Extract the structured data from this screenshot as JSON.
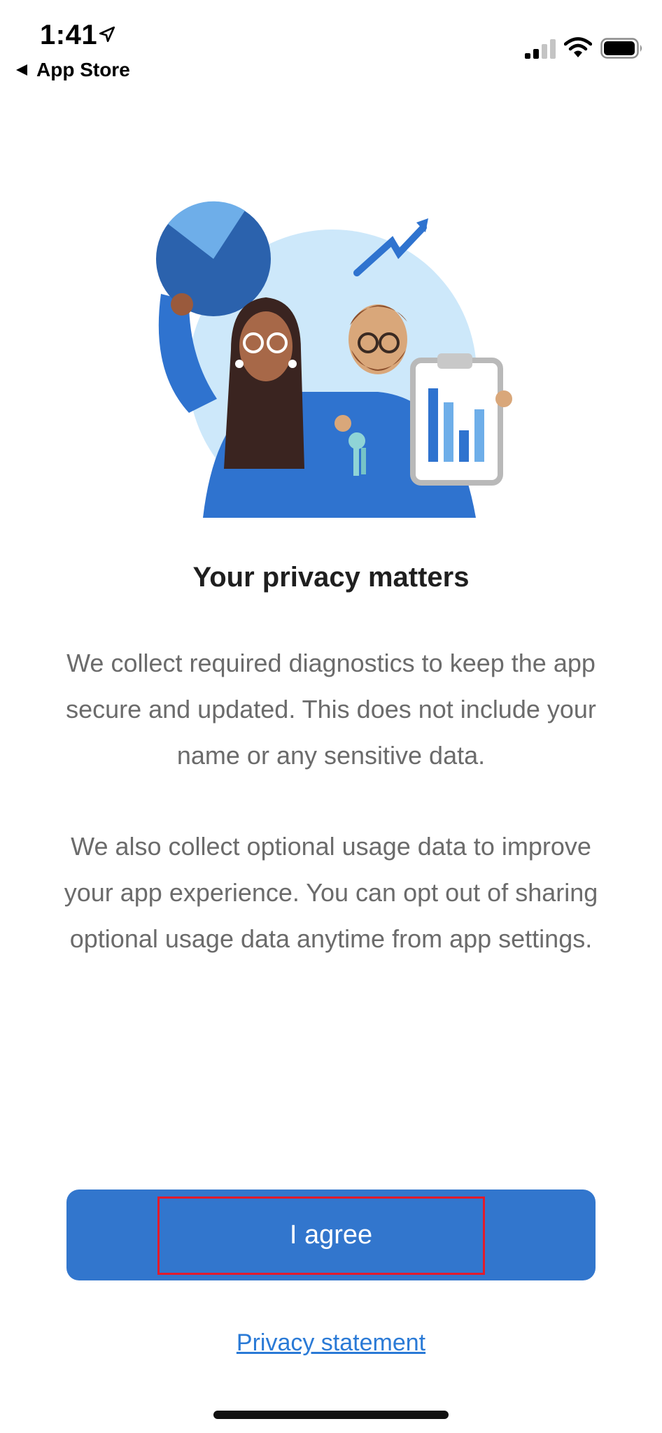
{
  "status_bar": {
    "time": "1:41",
    "back_label": "App Store"
  },
  "content": {
    "title": "Your privacy matters",
    "paragraph1": "We collect required diagnostics to keep the app secure and updated. This does not include your name or any sensitive data.",
    "paragraph2": "We also collect optional usage data to improve your app experience. You can opt out of sharing optional usage data anytime from app settings."
  },
  "actions": {
    "agree_label": "I agree",
    "privacy_label": "Privacy statement"
  },
  "colors": {
    "accent": "#3276cd",
    "link": "#2a7ad6",
    "highlight": "#e21b2c"
  },
  "icons": {
    "illustration": "privacy-illustration",
    "location": "location-arrow-icon",
    "back": "back-triangle-icon",
    "signal": "cellular-signal-icon",
    "wifi": "wifi-icon",
    "battery": "battery-icon"
  }
}
